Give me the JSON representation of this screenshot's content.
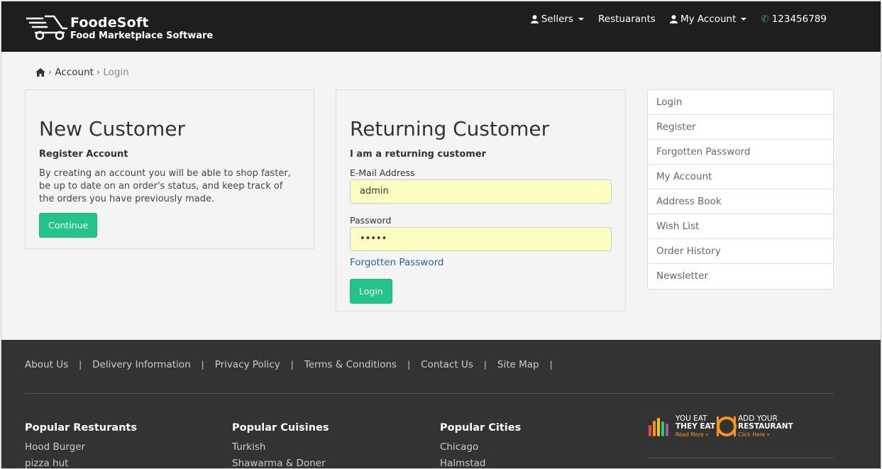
{
  "header": {
    "logo_title": "FoodeSoft",
    "logo_subtitle": "Food Marketplace Software",
    "nav": {
      "sellers": "Sellers",
      "restaurants": "Restuarants",
      "my_account": "My Account",
      "phone": "123456789"
    }
  },
  "breadcrumb": {
    "home_icon": "home-icon",
    "items": [
      "Account",
      "Login"
    ]
  },
  "new_customer": {
    "title": "New Customer",
    "subtitle": "Register Account",
    "description": "By creating an account you will be able to shop faster, be up to date on an order's status, and keep track of the orders you have previously made.",
    "button": "Continue"
  },
  "returning_customer": {
    "title": "Returning Customer",
    "subtitle": "I am a returning customer",
    "email_label": "E-Mail Address",
    "email_value": "admin",
    "password_label": "Password",
    "password_value": "•••••",
    "forgotten_link": "Forgotten Password",
    "button": "Login"
  },
  "sidebar": {
    "items": [
      "Login",
      "Register",
      "Forgotten Password",
      "My Account",
      "Address Book",
      "Wish List",
      "Order History",
      "Newsletter"
    ]
  },
  "footer": {
    "links": [
      "About Us",
      "Delivery Information",
      "Privacy Policy",
      "Terms & Conditions",
      "Contact Us",
      "Site Map"
    ],
    "columns": [
      {
        "title": "Popular Resturants",
        "items": [
          "Hood Burger",
          "pizza hut"
        ]
      },
      {
        "title": "Popular Cuisines",
        "items": [
          "Turkish",
          "Shawarma & Doner"
        ]
      },
      {
        "title": "Popular Cities",
        "items": [
          "Chicago",
          "Halmstad"
        ]
      }
    ],
    "promo": {
      "you_eat": "YOU EAT",
      "they_eat": "THEY EAT",
      "read_more": "Read More »",
      "add_your": "ADD YOUR",
      "restaurant": "RESTAURANT",
      "click_here": "Click Here »"
    }
  },
  "colors": {
    "header_bg": "#1e1e1e",
    "accent_green": "#22c48a",
    "autofill_yellow": "#fbffbf",
    "footer_bg": "#333333",
    "link_blue": "#2a6496"
  }
}
